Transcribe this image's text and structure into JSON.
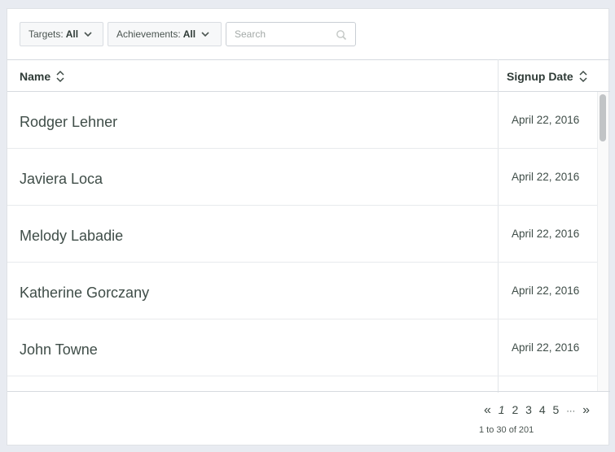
{
  "filters": {
    "targets": {
      "label": "Targets:",
      "value": "All"
    },
    "achievements": {
      "label": "Achievements:",
      "value": "All"
    }
  },
  "search": {
    "placeholder": "Search",
    "value": ""
  },
  "table": {
    "columns": [
      {
        "label": "Name"
      },
      {
        "label": "Signup Date"
      }
    ],
    "rows": [
      {
        "name": "Rodger Lehner",
        "date": "April 22, 2016"
      },
      {
        "name": "Javiera Loca",
        "date": "April 22, 2016"
      },
      {
        "name": "Melody Labadie",
        "date": "April 22, 2016"
      },
      {
        "name": "Katherine Gorczany",
        "date": "April 22, 2016"
      },
      {
        "name": "John Towne",
        "date": "April 22, 2016"
      }
    ]
  },
  "pagination": {
    "first": "«",
    "pages": [
      "1",
      "2",
      "3",
      "4",
      "5"
    ],
    "current": "1",
    "ellipsis": "···",
    "last": "»",
    "range_text": "1 to 30 of 201"
  },
  "colors": {
    "background": "#e8ebf1",
    "panel": "#ffffff",
    "text": "#3f4d48",
    "border": "#d6dadf"
  }
}
